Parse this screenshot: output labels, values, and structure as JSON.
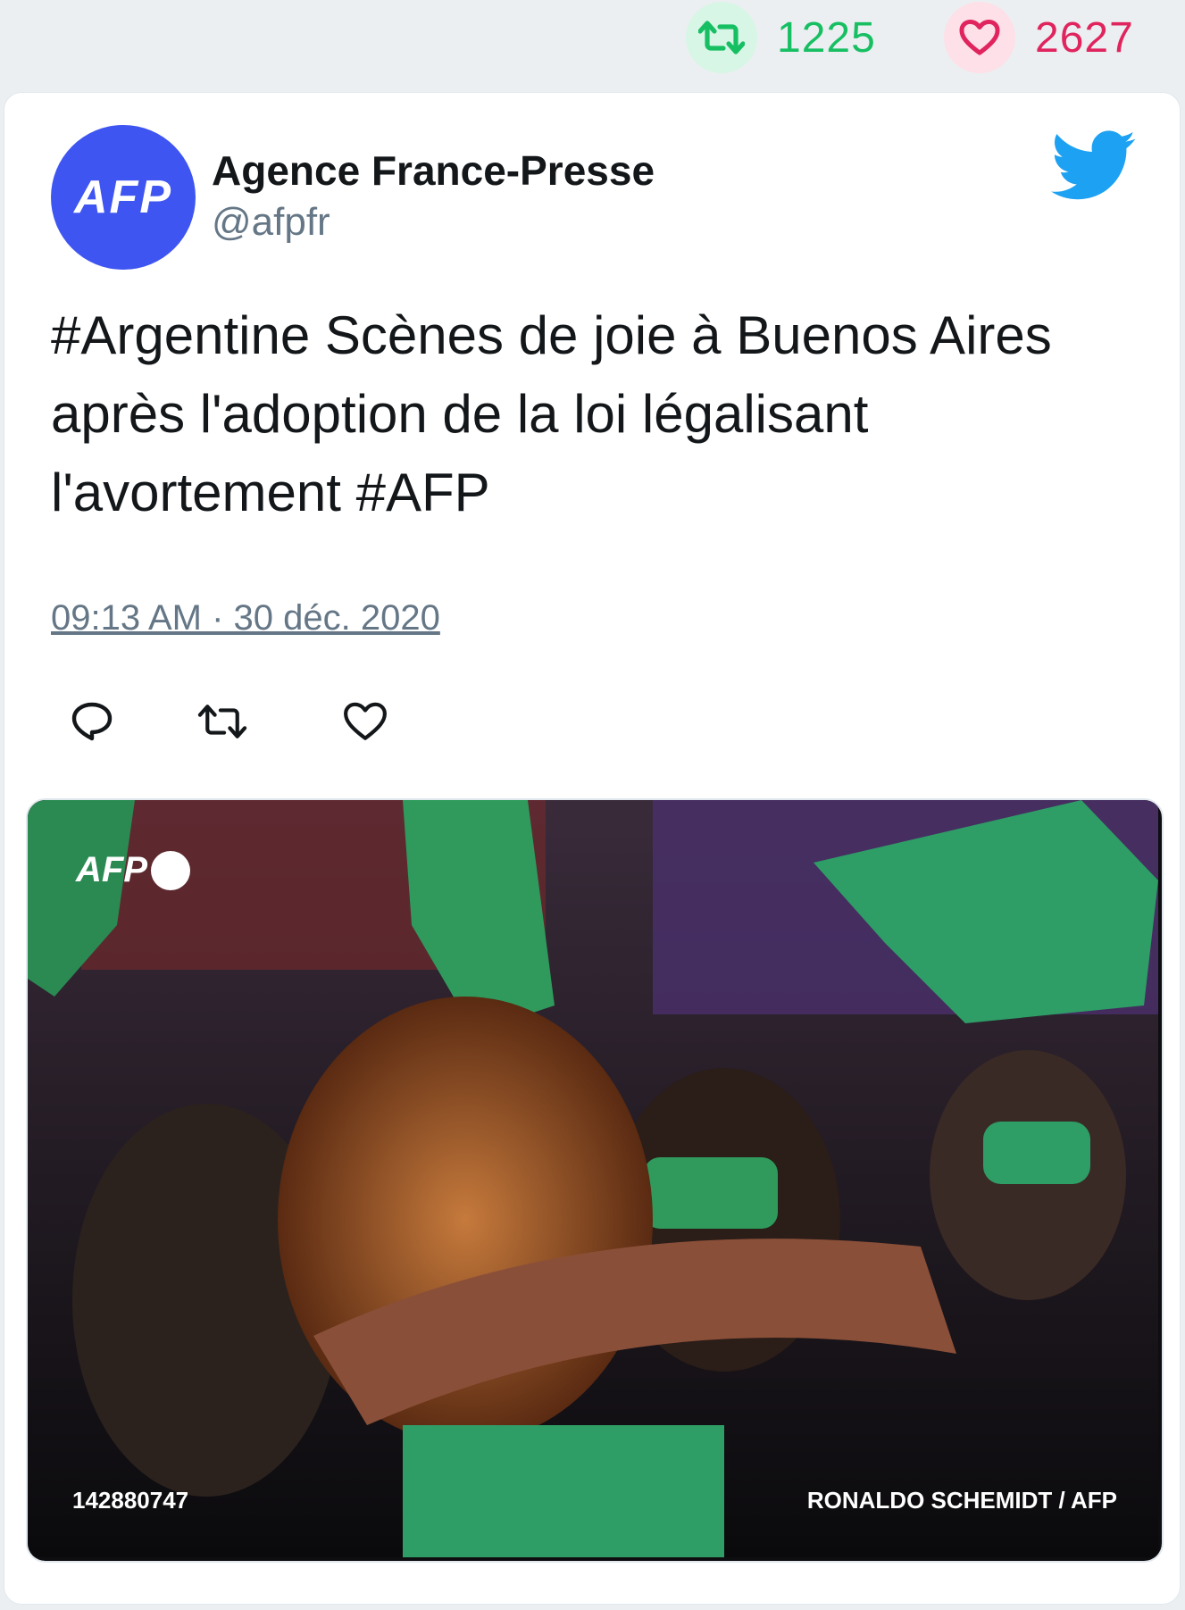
{
  "stats": {
    "retweet_count": "1225",
    "like_count": "2627",
    "retweet_color": "#17bf63",
    "like_color": "#e0245e"
  },
  "tweet": {
    "avatar_text": "AFP",
    "display_name": "Agence France-Presse",
    "handle": "@afpfr",
    "text": "#Argentine Scènes de joie à Buenos Aires après l'adoption de la loi légalisant l'avortement #AFP",
    "timestamp": "09:13 AM · 30 déc. 2020",
    "brand_color": "#1da1f2"
  },
  "media": {
    "logo_text": "AFP",
    "image_id": "142880747",
    "credit": "RONALDO SCHEMIDT / AFP"
  },
  "icons": [
    "retweet-icon",
    "heart-icon",
    "twitter-bird-icon",
    "reply-icon"
  ]
}
